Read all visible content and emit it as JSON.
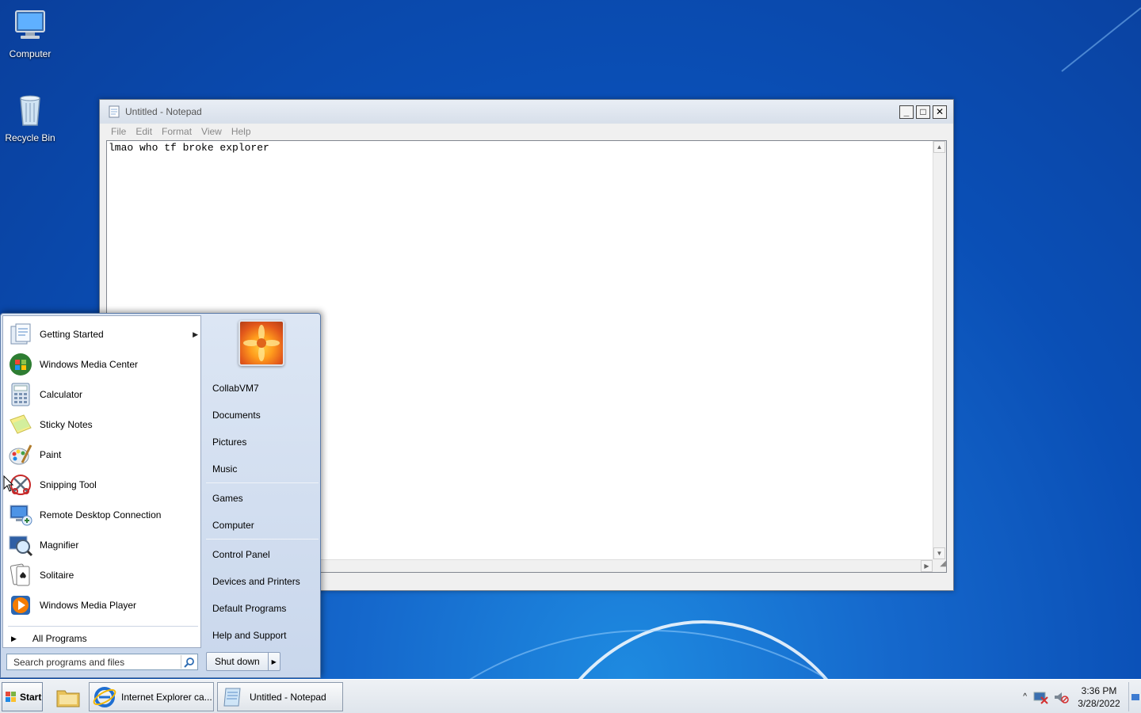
{
  "desktop": {
    "icons": [
      {
        "label": "Computer"
      },
      {
        "label": "Recycle Bin"
      }
    ]
  },
  "notepad": {
    "title": "Untitled - Notepad",
    "menu": [
      "File",
      "Edit",
      "Format",
      "View",
      "Help"
    ],
    "content": "lmao who tf broke explorer",
    "buttons": {
      "minimize": "_",
      "maximize": "□",
      "close": "✕"
    }
  },
  "start_menu": {
    "programs": [
      {
        "label": "Getting Started",
        "icon": "getting-started-icon",
        "has_submenu": true
      },
      {
        "label": "Windows Media Center",
        "icon": "media-center-icon",
        "has_submenu": false
      },
      {
        "label": "Calculator",
        "icon": "calculator-icon",
        "has_submenu": false
      },
      {
        "label": "Sticky Notes",
        "icon": "sticky-notes-icon",
        "has_submenu": false
      },
      {
        "label": "Paint",
        "icon": "paint-icon",
        "has_submenu": false
      },
      {
        "label": "Snipping Tool",
        "icon": "snipping-tool-icon",
        "has_submenu": false
      },
      {
        "label": "Remote Desktop Connection",
        "icon": "remote-desktop-icon",
        "has_submenu": false
      },
      {
        "label": "Magnifier",
        "icon": "magnifier-icon",
        "has_submenu": false
      },
      {
        "label": "Solitaire",
        "icon": "solitaire-icon",
        "has_submenu": false
      },
      {
        "label": "Windows Media Player",
        "icon": "media-player-icon",
        "has_submenu": false
      }
    ],
    "all_programs": "All Programs",
    "search_placeholder": "Search programs and files",
    "right_links": {
      "user": "CollabVM7",
      "documents": "Documents",
      "pictures": "Pictures",
      "music": "Music",
      "games": "Games",
      "computer": "Computer",
      "control_panel": "Control Panel",
      "devices": "Devices and Printers",
      "default_programs": "Default Programs",
      "help": "Help and Support"
    },
    "shutdown": "Shut down"
  },
  "taskbar": {
    "start": "Start",
    "items": [
      {
        "label": "Internet Explorer ca..."
      },
      {
        "label": "Untitled - Notepad"
      }
    ],
    "clock": {
      "time": "3:36 PM",
      "date": "3/28/2022"
    }
  }
}
